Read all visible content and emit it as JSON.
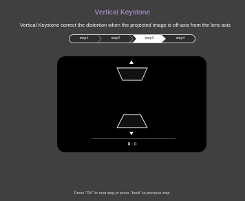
{
  "header": {
    "title": "Vertical Keystone",
    "description": "Vertical Keystone correct the distortion when the projected image is off-axis from the lens axis"
  },
  "steps": {
    "items": [
      {
        "label": "step1",
        "active": false
      },
      {
        "label": "step2",
        "active": false
      },
      {
        "label": "step3",
        "active": true
      },
      {
        "label": "step4",
        "active": false
      }
    ]
  },
  "keystone": {
    "value_icon": "up-down-arrows-icon",
    "value": ": 0",
    "up_arrow": "▲",
    "down_arrow": "▼",
    "up_down_glyph": "⬍"
  },
  "footer": {
    "hint": "Press \"OK\" to next step,or press \"back\" to previous step."
  },
  "colors": {
    "background": "#404040",
    "title": "#b9a0e0",
    "panel": "#000000",
    "active_step": "#ffffff"
  }
}
